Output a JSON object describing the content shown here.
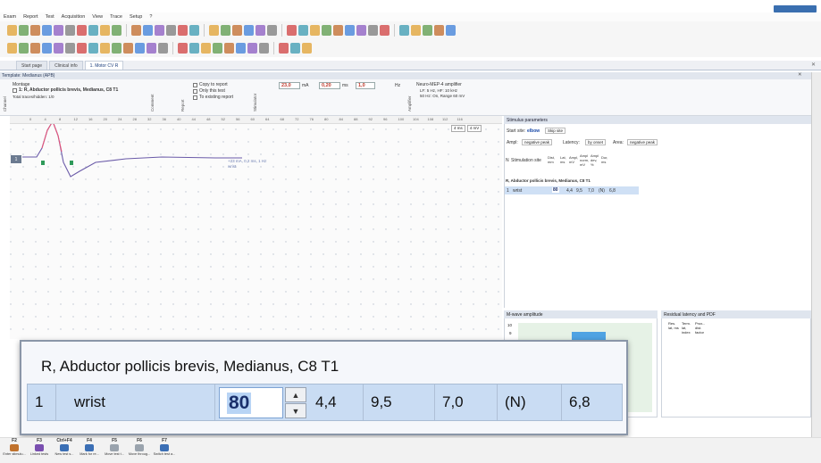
{
  "menu": [
    "Exam",
    "Report",
    "Test",
    "Acquisition",
    "View",
    "Trace",
    "Setup",
    "?"
  ],
  "tabs": [
    {
      "label": "Start page",
      "active": false
    },
    {
      "label": "Clinical info",
      "active": false
    },
    {
      "label": "1. Motor CV R",
      "active": true
    }
  ],
  "template": {
    "label": "Template: Medianus (APB)"
  },
  "montage": {
    "section_label": "Montage",
    "channel_vlabel": "Channel",
    "comment_vlabel": "Comment",
    "report_vlabel": "Report",
    "stimulator_vlabel": "Stimulator",
    "amplifier_vlabel": "Amplifier",
    "muscle": "1: R, Abductor pollicis brevis, Medianus, C8 T1",
    "traces": "Total traces/hidden: 1/0",
    "copy_to_report": "Copy to report",
    "only_this_test": "Only this test",
    "to_existing_report": "To existing report",
    "duration": "23,0",
    "duration_unit": "mA",
    "pulse_width": "0,20",
    "pulse_unit": "ms",
    "frequency": "1,0",
    "frequency_unit": "Hz",
    "amplifier_name": "Neuro-MEP-4 amplifier",
    "amplifier_line1": "LF: 5 Hz, HF: 10 kHz",
    "amplifier_line2": "50 Hz: On, Range 60 mV"
  },
  "plot": {
    "ruler_ticks": [
      "0",
      "4",
      "8",
      "12",
      "16",
      "20",
      "24",
      "28",
      "32",
      "36",
      "40",
      "44",
      "48",
      "52",
      "56",
      "60",
      "64",
      "68",
      "72",
      "76",
      "80",
      "84",
      "88",
      "92",
      "96",
      "100",
      "104",
      "108",
      "112",
      "116"
    ],
    "channel_badge": "1",
    "trace_annotation": "+23 mA, 0,2 ms, 1 Hz",
    "trace_annotation2": "wrist",
    "scale_time": "4 ms",
    "scale_amp": "4 mV"
  },
  "stimulus_params": {
    "title": "Stimulus parameters",
    "start_site_label": "Start site:",
    "start_site_value": "elbow",
    "skip_site": "Skip site",
    "ampl_label": "Ampl:",
    "ampl_value": "negative peak",
    "latency_label": "Latency:",
    "latency_value": "by onset",
    "area_label": "Area:",
    "area_value": "negative peak",
    "columns": [
      "N",
      "Stimulation site",
      "Dist, mm",
      "Lat, ms",
      "Ampl, mV",
      "Ampl norm, mV",
      "Ampl dev, %",
      "Dur, ms"
    ],
    "group_row": "R, Abductor pollicis brevis, Medianus, C8 T1",
    "rows": [
      [
        "1",
        "wrist",
        "80",
        "4,4",
        "9,5",
        "7,0",
        "(N)",
        "6,8"
      ]
    ]
  },
  "mwave": {
    "title": "M-wave amplitude",
    "y_tick_top": "10",
    "y_tick_2": "9"
  },
  "residual": {
    "title": "Residual latency and PDF",
    "columns": [
      "Res. lat, ms",
      "Term. lat, index",
      "Prox.-dist. factor"
    ]
  },
  "zoom": {
    "title": "R, Abductor pollicis brevis, Medianus, C8 T1",
    "n": "1",
    "site": "wrist",
    "distance": "80",
    "latency": "4,4",
    "amplitude": "9,5",
    "amplitude_norm": "7,0",
    "amplitude_dev": "(N)",
    "duration": "6,8",
    "spin_up": "▲",
    "spin_down": "▼"
  },
  "fkeys": [
    {
      "key": "F2",
      "label": "Enter stimulu...",
      "color": "#c0722d"
    },
    {
      "key": "F3",
      "label": "Linked tests",
      "color": "#7a4fb0"
    },
    {
      "key": "Ctrl+F4",
      "label": "New test s...",
      "color": "#3b6fb5"
    },
    {
      "key": "F4",
      "label": "Mark for re...",
      "color": "#3b6fb5"
    },
    {
      "key": "F5",
      "label": "Move test t...",
      "color": "#9aa3ad"
    },
    {
      "key": "F6",
      "label": "Move throug...",
      "color": "#9aa3ad"
    },
    {
      "key": "F7",
      "label": "Switch test a...",
      "color": "#3b6fb5"
    }
  ],
  "colors": {
    "selection": "#c9dcf3",
    "trace": "#6a5aa8",
    "trace_hi": "#e5557a",
    "marker": "#2f9a5a",
    "accent_blue": "#4fa3e3"
  }
}
